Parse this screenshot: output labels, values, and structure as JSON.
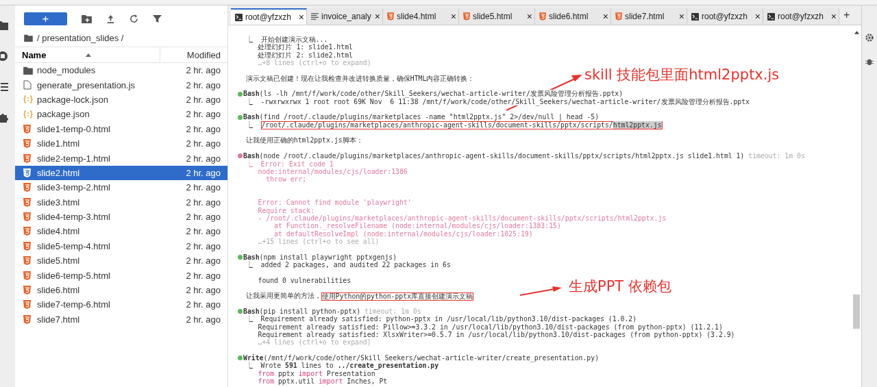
{
  "file_browser": {
    "new_button": "+",
    "breadcrumb": "/ presentation_slides /",
    "columns": [
      {
        "label": "Name",
        "sorted": true
      },
      {
        "label": "Modified",
        "sorted": false
      }
    ],
    "files": [
      {
        "name": "node_modules",
        "modified": "2 hr. ago",
        "kind": "folder",
        "selected": false
      },
      {
        "name": "generate_presentation.js",
        "modified": "2 hr. ago",
        "kind": "file",
        "selected": false
      },
      {
        "name": "package-lock.json",
        "modified": "2 hr. ago",
        "kind": "json",
        "selected": false
      },
      {
        "name": "package.json",
        "modified": "2 hr. ago",
        "kind": "json",
        "selected": false
      },
      {
        "name": "slide1-temp-0.html",
        "modified": "2 hr. ago",
        "kind": "html",
        "selected": false
      },
      {
        "name": "slide1.html",
        "modified": "2 hr. ago",
        "kind": "html",
        "selected": false
      },
      {
        "name": "slide2-temp-1.html",
        "modified": "2 hr. ago",
        "kind": "html",
        "selected": false
      },
      {
        "name": "slide2.html",
        "modified": "2 hr. ago",
        "kind": "html",
        "selected": true
      },
      {
        "name": "slide3-temp-2.html",
        "modified": "2 hr. ago",
        "kind": "html",
        "selected": false
      },
      {
        "name": "slide3.html",
        "modified": "2 hr. ago",
        "kind": "html",
        "selected": false
      },
      {
        "name": "slide4-temp-3.html",
        "modified": "2 hr. ago",
        "kind": "html",
        "selected": false
      },
      {
        "name": "slide4.html",
        "modified": "2 hr. ago",
        "kind": "html",
        "selected": false
      },
      {
        "name": "slide5-temp-4.html",
        "modified": "2 hr. ago",
        "kind": "html",
        "selected": false
      },
      {
        "name": "slide5.html",
        "modified": "2 hr. ago",
        "kind": "html",
        "selected": false
      },
      {
        "name": "slide6-temp-5.html",
        "modified": "2 hr. ago",
        "kind": "html",
        "selected": false
      },
      {
        "name": "slide6.html",
        "modified": "2 hr. ago",
        "kind": "html",
        "selected": false
      },
      {
        "name": "slide7-temp-6.html",
        "modified": "2 hr. ago",
        "kind": "html",
        "selected": false
      },
      {
        "name": "slide7.html",
        "modified": "2 hr. ago",
        "kind": "html",
        "selected": false
      }
    ]
  },
  "tabs": [
    {
      "label": "root@yfzxzh",
      "kind": "terminal",
      "selected": true
    },
    {
      "label": "invoice_analy",
      "kind": "text",
      "selected": false
    },
    {
      "label": "slide4.html",
      "kind": "html",
      "selected": false
    },
    {
      "label": "slide5.html",
      "kind": "html",
      "selected": false
    },
    {
      "label": "slide6.html",
      "kind": "html",
      "selected": false
    },
    {
      "label": "slide7.html",
      "kind": "html",
      "selected": false
    },
    {
      "label": "root@yfzxzh",
      "kind": "terminal",
      "selected": false
    },
    {
      "label": "root@yfzxzh",
      "kind": "terminal",
      "selected": false
    }
  ],
  "tab_close": "×",
  "new_tab": "+",
  "terminal": [
    {
      "kind": "text",
      "text": "  ⎿  开始创建演示文稿..."
    },
    {
      "kind": "text",
      "text": "     处理幻灯片 1: slide1.html"
    },
    {
      "kind": "text",
      "text": "     处理幻灯片 2: slide2.html"
    },
    {
      "kind": "dim",
      "text": "     …+8 lines (ctrl+o to expand)"
    },
    {
      "kind": "blank"
    },
    {
      "kind": "text",
      "text": "  演示文稿已创建！现在让我检查并改进转换质量，确保HTML内容正确转换："
    },
    {
      "kind": "blank"
    },
    {
      "kind": "tool",
      "color": "#5cb85c",
      "text": "**Bash**(ls -lh /mnt/f/work/code/other/Skill_Seekers/wechat-article-writer/发票风险管理分析报告.pptx)"
    },
    {
      "kind": "text",
      "text": "  ⎿  -rwxrwxrwx 1 root root 69K Nov  6 11:38 /mnt/f/work/code/other/Skill_Seekers/wechat-article-writer/发票风险管理分析报告.pptx"
    },
    {
      "kind": "blank"
    },
    {
      "kind": "tool",
      "color": "#5cb85c",
      "text": "**Bash**(find /root/.claude/plugins/marketplaces -name \"html2pptx.js\" 2>/dev/null | head -5)"
    },
    {
      "kind": "boxed",
      "text": "  ⎿  ",
      "boxed": "/root/.claude/plugins/marketplaces/anthropic-agent-skills/document-skills/pptx/scripts/",
      "highlighted": "html2pptx.js"
    },
    {
      "kind": "blank"
    },
    {
      "kind": "text",
      "text": "  让我使用正确的html2pptx.js脚本："
    },
    {
      "kind": "blank"
    },
    {
      "kind": "tool",
      "color": "#e07a9a",
      "text": "**Bash**(node /root/.claude/plugins/marketplaces/anthropic-agent-skills/document-skills/pptx/scripts/html2pptx.js slide1.html 1)",
      "timeout": "timeout: 1m 0s"
    },
    {
      "kind": "error",
      "text": "  ⎿  Error: Exit code 1"
    },
    {
      "kind": "error",
      "text": "     node:internal/modules/cjs/loader:1386"
    },
    {
      "kind": "error",
      "text": "       throw err;"
    },
    {
      "kind": "blank"
    },
    {
      "kind": "blank"
    },
    {
      "kind": "error",
      "text": "     Error: Cannot find module 'playwright'"
    },
    {
      "kind": "error",
      "text": "     Require stack:"
    },
    {
      "kind": "error",
      "text": "     - /root/.claude/plugins/marketplaces/anthropic-agent-skills/document-skills/pptx/scripts/html2pptx.js"
    },
    {
      "kind": "error",
      "text": "         at Function._resolveFilename (node:internal/modules/cjs/loader:1383:15)"
    },
    {
      "kind": "error",
      "text": "         at defaultResolveImpl (node:internal/modules/cjs/loader:1025:19)"
    },
    {
      "kind": "dim",
      "text": "     …+15 lines (ctrl+o to see all)"
    },
    {
      "kind": "blank"
    },
    {
      "kind": "tool",
      "color": "#5cb85c",
      "text": "**Bash**(npm install playwright pptxgenjs)"
    },
    {
      "kind": "text",
      "text": "  ⎿  added 2 packages, and audited 22 packages in 6s"
    },
    {
      "kind": "blank"
    },
    {
      "kind": "text",
      "text": "     found 0 vulnerabilities"
    },
    {
      "kind": "blank"
    },
    {
      "kind": "boxed",
      "text": "  让我采用更简单的方法，",
      "boxed": "使用Python的python-pptx库直接创建演示文稿"
    },
    {
      "kind": "blank"
    },
    {
      "kind": "tool",
      "color": "#5cb85c",
      "text": "**Bash**(pip install python-pptx)",
      "timeout": "timeout: 1m 0s"
    },
    {
      "kind": "text",
      "text": "  ⎿  Requirement already satisfied: python-pptx in /usr/local/lib/python3.10/dist-packages (1.0.2)"
    },
    {
      "kind": "text",
      "text": "     Requirement already satisfied: Pillow>=3.3.2 in /usr/local/lib/python3.10/dist-packages (from python-pptx) (11.2.1)"
    },
    {
      "kind": "text",
      "text": "     Requirement already satisfied: XlsxWriter>=0.5.7 in /usr/local/lib/python3.10/dist-packages (from python-pptx) (3.2.9)"
    },
    {
      "kind": "dim",
      "text": "     …+4 lines (ctrl+o to expand)"
    },
    {
      "kind": "blank"
    },
    {
      "kind": "tool",
      "color": "#5cb85c",
      "text": "**Write**(/mnt/f/work/code/other/Skill_Seekers/wechat-article-writer/create_presentation.py)"
    },
    {
      "kind": "text",
      "text": "  ⎿  Wrote **591** lines to **../create_presentation.py**"
    },
    {
      "kind": "code",
      "parts": [
        {
          "text": "from",
          "kind": "keyword"
        },
        {
          "text": " pptx ",
          "kind": "plain"
        },
        {
          "text": "import",
          "kind": "keyword"
        },
        {
          "text": " Presentation",
          "kind": "plain"
        }
      ]
    },
    {
      "kind": "code",
      "parts": [
        {
          "text": "from",
          "kind": "keyword"
        },
        {
          "text": " pptx.util ",
          "kind": "plain"
        },
        {
          "text": "import",
          "kind": "keyword"
        },
        {
          "text": " Inches, Pt",
          "kind": "plain"
        }
      ]
    }
  ],
  "annotations": [
    {
      "text": "skill 技能包里面html2pptx.js"
    },
    {
      "text": "生成PPT 依赖包"
    }
  ]
}
